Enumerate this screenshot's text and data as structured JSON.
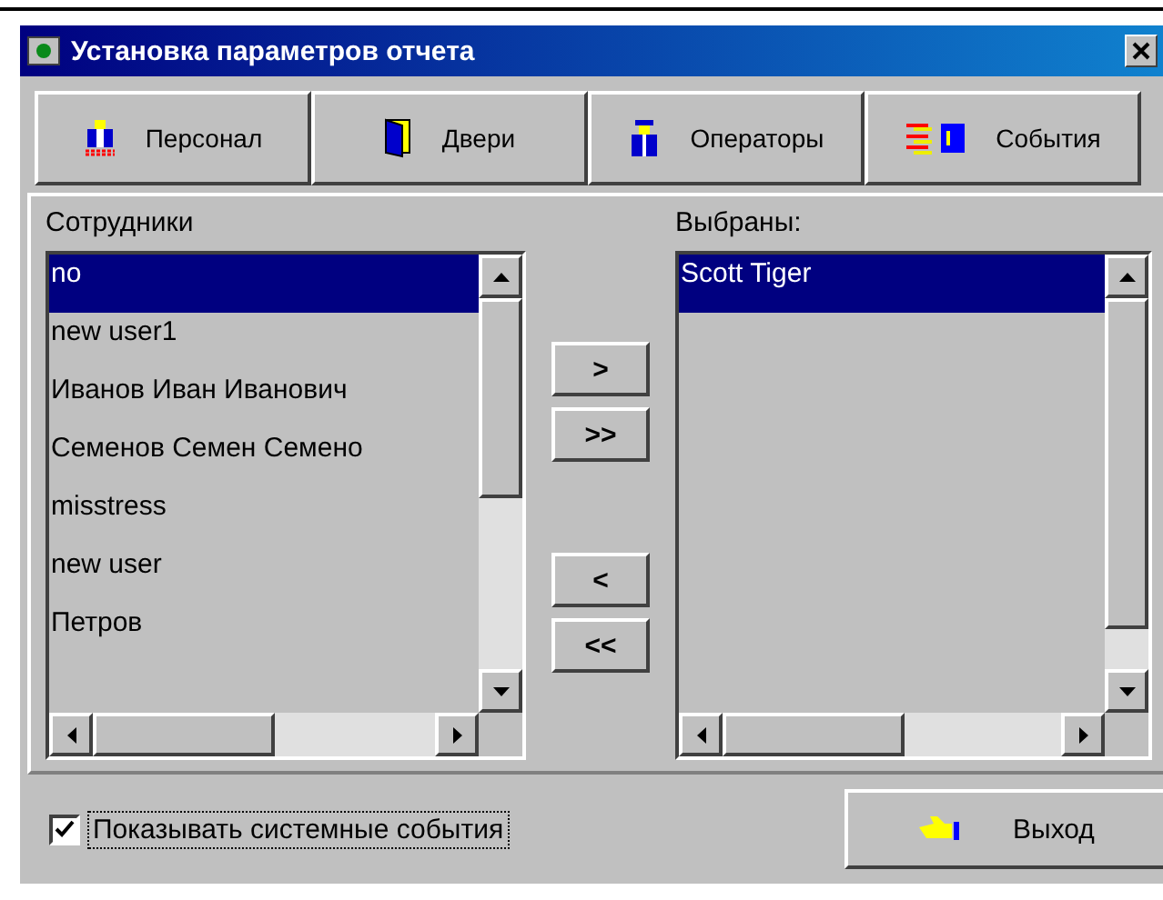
{
  "window": {
    "title": "Установка параметров отчета"
  },
  "toolbar": [
    {
      "label": "Персонал",
      "kind": "staff"
    },
    {
      "label": "Двери",
      "kind": "door"
    },
    {
      "label": "Операторы",
      "kind": "operator"
    },
    {
      "label": "События",
      "kind": "events"
    }
  ],
  "employees": {
    "label": "Сотрудники",
    "items": [
      {
        "text": "no",
        "selected": true
      },
      {
        "text": "new user1",
        "selected": false
      },
      {
        "text": "Иванов Иван Иванович",
        "selected": false
      },
      {
        "text": "Семенов Семен Семено",
        "selected": false
      },
      {
        "text": "misstress",
        "selected": false
      },
      {
        "text": "new user",
        "selected": false
      },
      {
        "text": "Петров",
        "selected": false
      }
    ]
  },
  "move_buttons": [
    ">",
    ">>",
    "<",
    "<<"
  ],
  "chosen": {
    "label": "Выбраны:",
    "items": [
      {
        "text": "Scott Tiger",
        "selected": true
      }
    ]
  },
  "show_system_events": {
    "label": "Показывать системные события",
    "checked": true
  },
  "exit_button": {
    "label": "Выход"
  }
}
